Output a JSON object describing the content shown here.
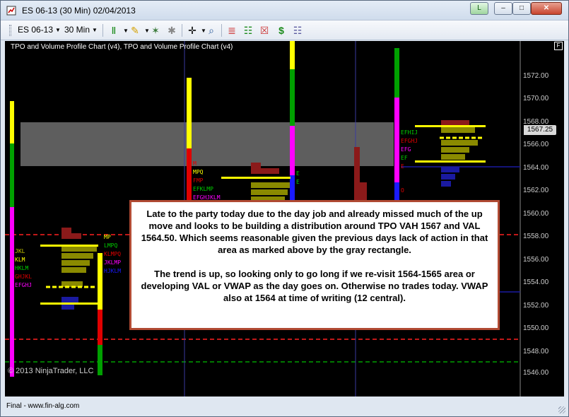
{
  "window": {
    "title": "ES 06-13 (30 Min)  02/04/2013",
    "link_button": "L",
    "minimize_icon": "minimize-icon",
    "maximize_icon": "maximize-icon",
    "close_icon": "close-icon"
  },
  "toolbar": {
    "instrument": "ES 06-13",
    "period": "30 Min",
    "icons": [
      "bar-style-icon",
      "drawing-tools-icon",
      "tools-icon",
      "chart-trader-icon",
      "crosshair-icon",
      "zoom-icon",
      "indicators-icon",
      "strategies-icon",
      "data-box-icon",
      "properties-icon"
    ]
  },
  "chart": {
    "indicator_label": "TPO and Volume Profile Chart (v4),  TPO and Volume Profile Chart (v4)",
    "f_badge": "F",
    "price_axis": [
      "1572.00",
      "1570.00",
      "1568.00",
      "1566.00",
      "1564.00",
      "1562.00",
      "1560.00",
      "1558.00",
      "1556.00",
      "1554.00",
      "1552.00",
      "1550.00",
      "1548.00",
      "1546.00"
    ],
    "current_price": "1567.25",
    "copyright": "© 2013 NinjaTrader, LLC",
    "colors": {
      "background": "#000000",
      "gray_zone": "#6e6e6e",
      "poc_yellow": "#ffff00",
      "profile_olive": "#8a8a00",
      "profile_red": "#8b1a1a",
      "profile_blue": "#1a1aa0",
      "dashed_red": "#ff2020",
      "dashed_green": "#00a000"
    }
  },
  "annotation": {
    "paragraph1": "Late to the party today due to the day job and already missed much of the up move and looks to be building a distribution around TPO VAH 1567 and VAL 1564.50.  Which seems reasonable given the previous days lack of action in that area as marked above by the gray rectangle.",
    "paragraph2": "The trend is up, so looking only to go long if we re-visit 1564-1565 area or developing VAL or VWAP as the day goes on. Otherwise no trades today.  VWAP also at 1564 at time of writing (12 central)."
  },
  "status": {
    "text": "Final - www.fin-alg.com"
  }
}
